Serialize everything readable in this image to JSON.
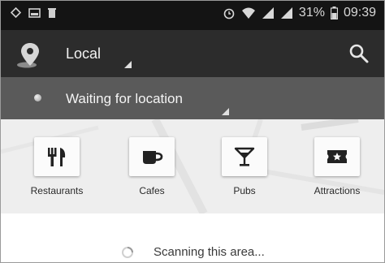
{
  "status_bar": {
    "battery_percent": "31%",
    "time": "09:39",
    "left_icons": [
      "settings-dot-icon",
      "image-icon",
      "trash-icon"
    ],
    "right_icons": [
      "alarm-icon",
      "wifi-icon",
      "signal-icon",
      "signal-icon",
      "battery-icon"
    ]
  },
  "action_bar": {
    "title": "Local",
    "icon": "location-pin-icon",
    "action_icon": "search-icon"
  },
  "location_bar": {
    "text": "Waiting for location"
  },
  "categories": [
    {
      "label": "Restaurants",
      "icon": "cutlery-icon"
    },
    {
      "label": "Cafes",
      "icon": "coffee-cup-icon"
    },
    {
      "label": "Pubs",
      "icon": "cocktail-icon"
    },
    {
      "label": "Attractions",
      "icon": "ticket-icon"
    }
  ],
  "content": {
    "status_text": "Scanning this area..."
  },
  "colors": {
    "status_bar": "#141414",
    "action_bar": "#2c2c2c",
    "location_bar": "#5a5a5a",
    "category_strip": "#eeeeee"
  }
}
